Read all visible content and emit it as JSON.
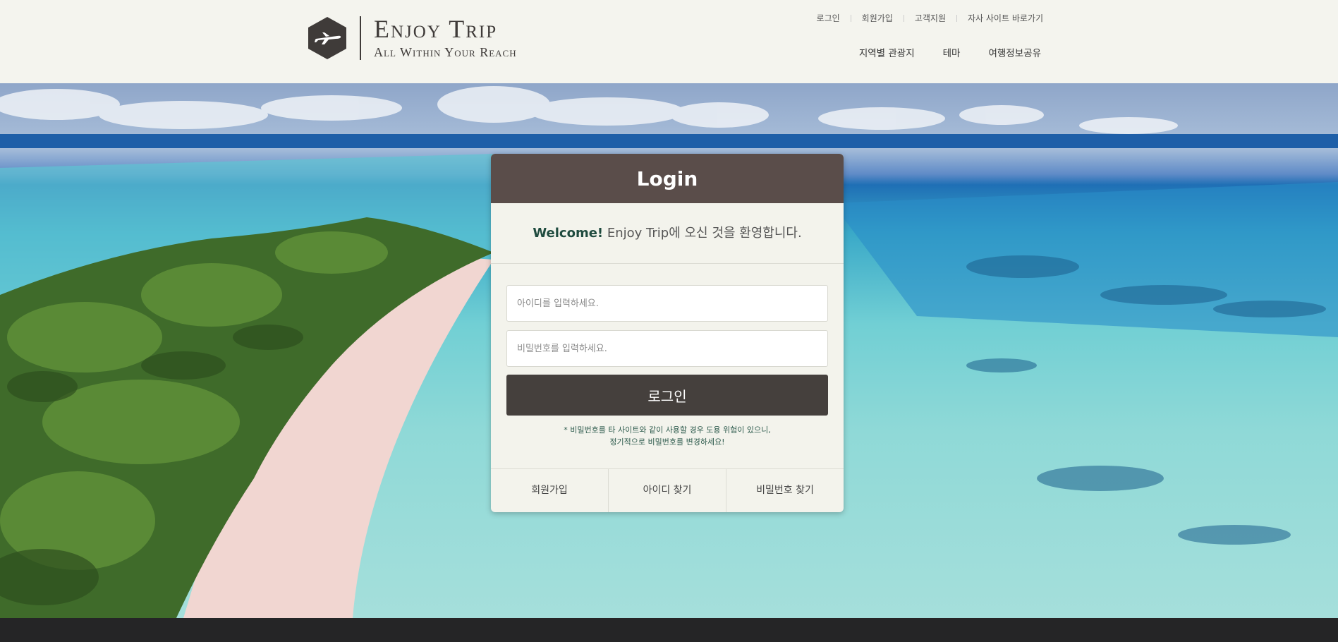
{
  "header": {
    "logo_title": "Enjoy Trip",
    "logo_subtitle": "All Within Your Reach",
    "top_links": [
      "로그인",
      "회원가입",
      "고객지원",
      "자사 사이트 바로가기"
    ],
    "nav": [
      "지역별 관광지",
      "테마",
      "여행정보공유"
    ]
  },
  "login": {
    "title": "Login",
    "welcome_strong": "Welcome!",
    "welcome_text": " Enjoy Trip에 오신 것을 환영합니다.",
    "id_placeholder": "아이디를 입력하세요.",
    "pw_placeholder": "비밀번호를 입력하세요.",
    "submit_label": "로그인",
    "notice_line1": "* 비밀번호를 타 사이트와 같이 사용할 경우 도용 위험이 있으니,",
    "notice_line2": "정기적으로 비밀번호를 변경하세요!",
    "footer_links": [
      "회원가입",
      "아이디 찾기",
      "비밀번호 찾기"
    ]
  },
  "colors": {
    "header_bg": "#f4f4ee",
    "card_header": "#5a4d4a",
    "button": "#45403d",
    "accent_text": "#1f4b3f",
    "footer_bar": "#252526"
  },
  "icons": [
    "airplane-icon"
  ]
}
